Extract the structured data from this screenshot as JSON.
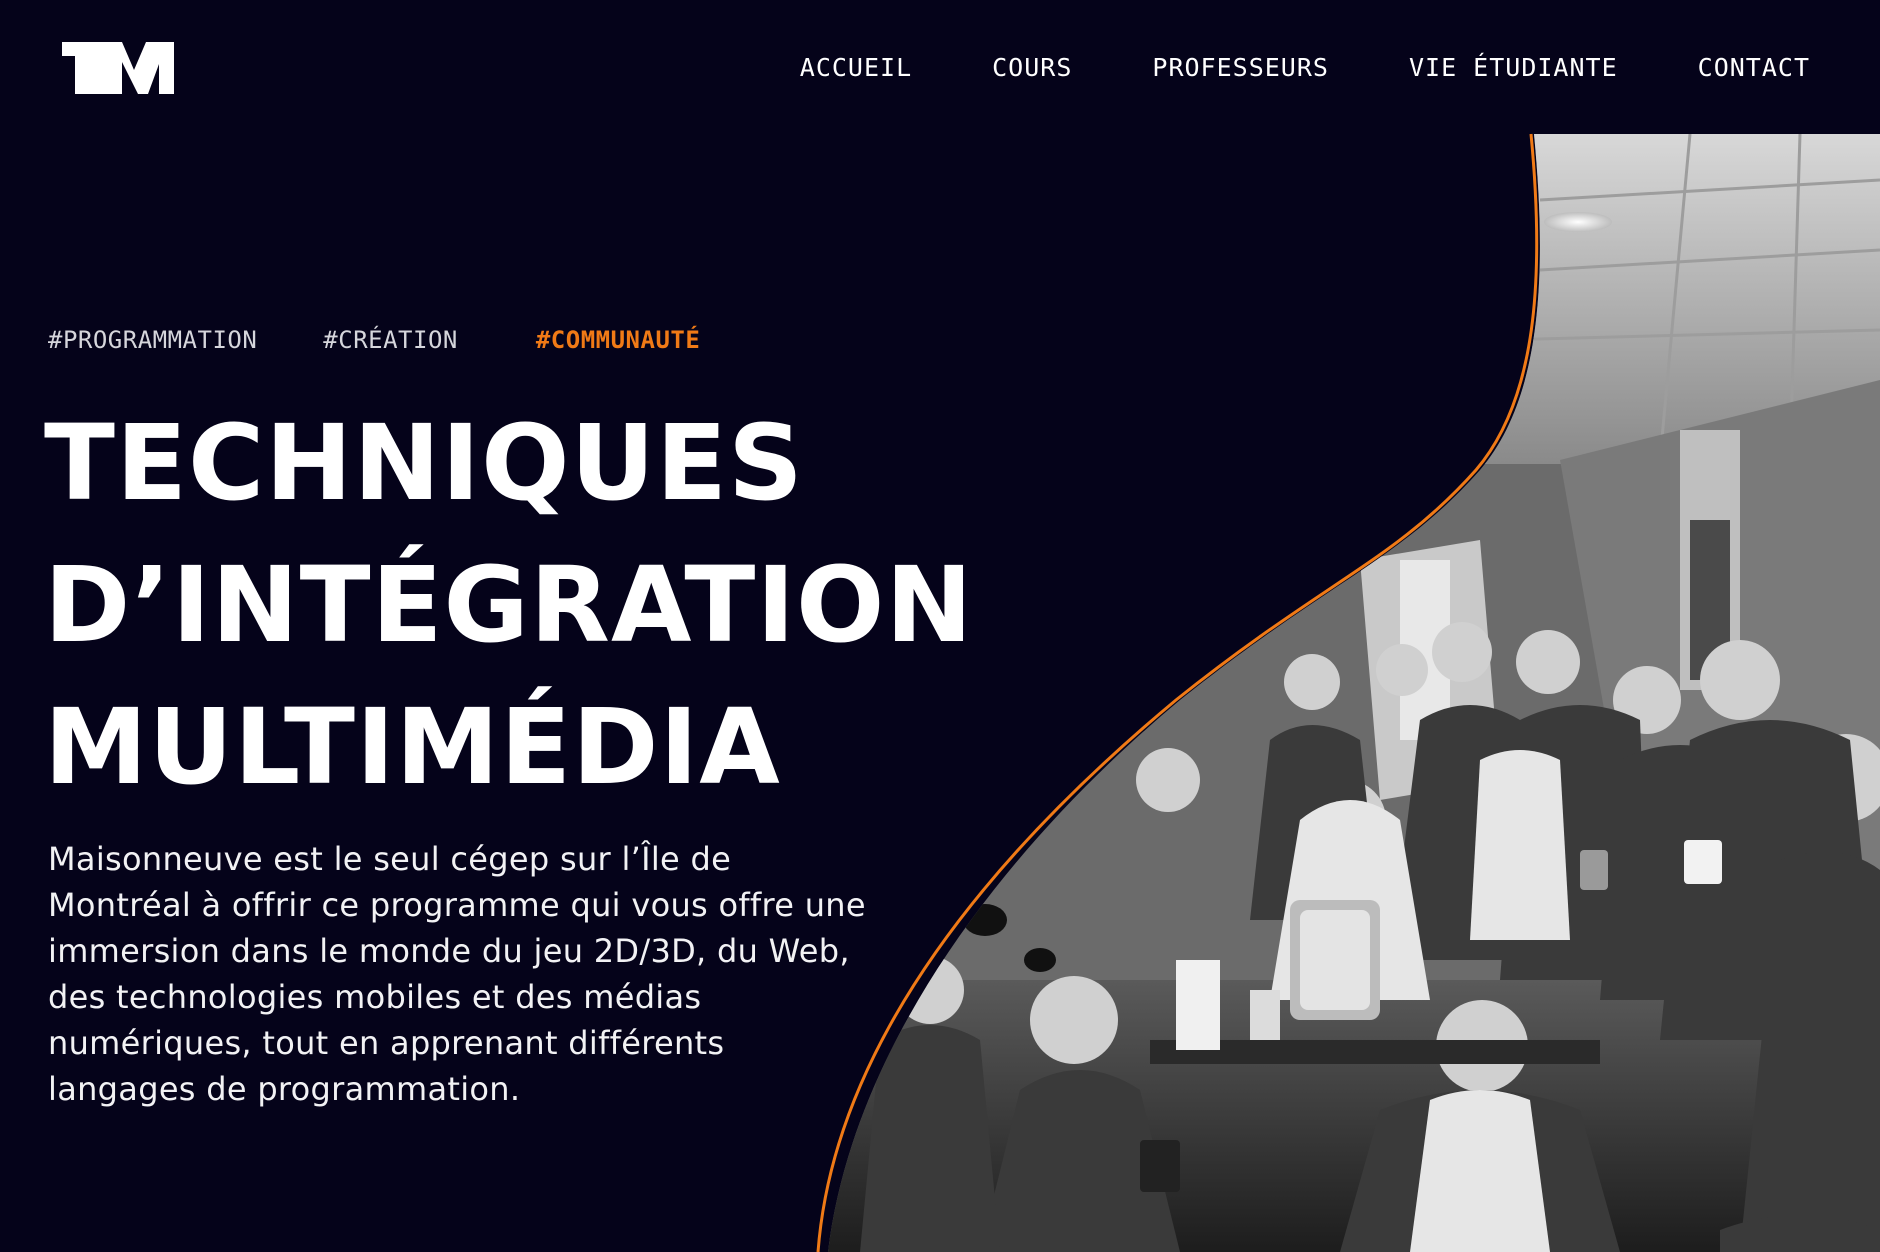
{
  "brand": {
    "logo_text": "TM"
  },
  "nav": {
    "items": [
      {
        "label": "ACCUEIL"
      },
      {
        "label": "COURS"
      },
      {
        "label": "PROFESSEURS"
      },
      {
        "label": "VIE ÉTUDIANTE"
      },
      {
        "label": "CONTACT"
      }
    ]
  },
  "hero": {
    "tags": [
      {
        "label": "#PROGRAMMATION",
        "active": false
      },
      {
        "label": "#CRÉATION",
        "active": false
      },
      {
        "label": "#COMMUNAUTÉ",
        "active": true
      }
    ],
    "title_lines": [
      "TECHNIQUES",
      "D’INTÉGRATION",
      "MULTIMÉDIA"
    ],
    "description": "Maisonneuve est le seul cégep sur l’Île de Montréal à offrir ce programme qui vous offre une immersion dans le monde du jeu 2D/3D, du Web, des technologies mobiles et des médias numériques, tout en apprenant différents langages de programmation.",
    "photo_icon": "group-photo-black-and-white"
  },
  "colors": {
    "background": "#05031a",
    "accent": "#f07a16",
    "text": "#ffffff"
  }
}
